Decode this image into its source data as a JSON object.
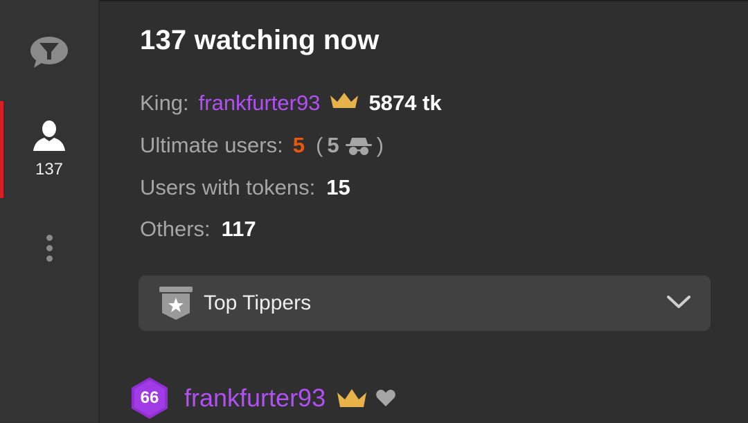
{
  "sidebar": {
    "users_count": "137"
  },
  "main": {
    "heading": "137 watching now",
    "king": {
      "label": "King:",
      "name": "frankfurter93",
      "tokens": "5874 tk"
    },
    "ultimate": {
      "label": "Ultimate users:",
      "count": "5",
      "open_paren": "(",
      "hidden_count": "5",
      "close_paren": ")"
    },
    "tokens_users": {
      "label": "Users with tokens:",
      "count": "15"
    },
    "others": {
      "label": "Others:",
      "count": "117"
    },
    "top_tippers": {
      "label": "Top Tippers"
    },
    "tipper": {
      "level": "66",
      "name": "frankfurter93"
    }
  },
  "colors": {
    "background": "#2f2f2f",
    "accent_purple": "#b24ff5",
    "accent_orange": "#e8590c",
    "crown_gold": "#e8b24a",
    "active_red": "#d81f26"
  }
}
